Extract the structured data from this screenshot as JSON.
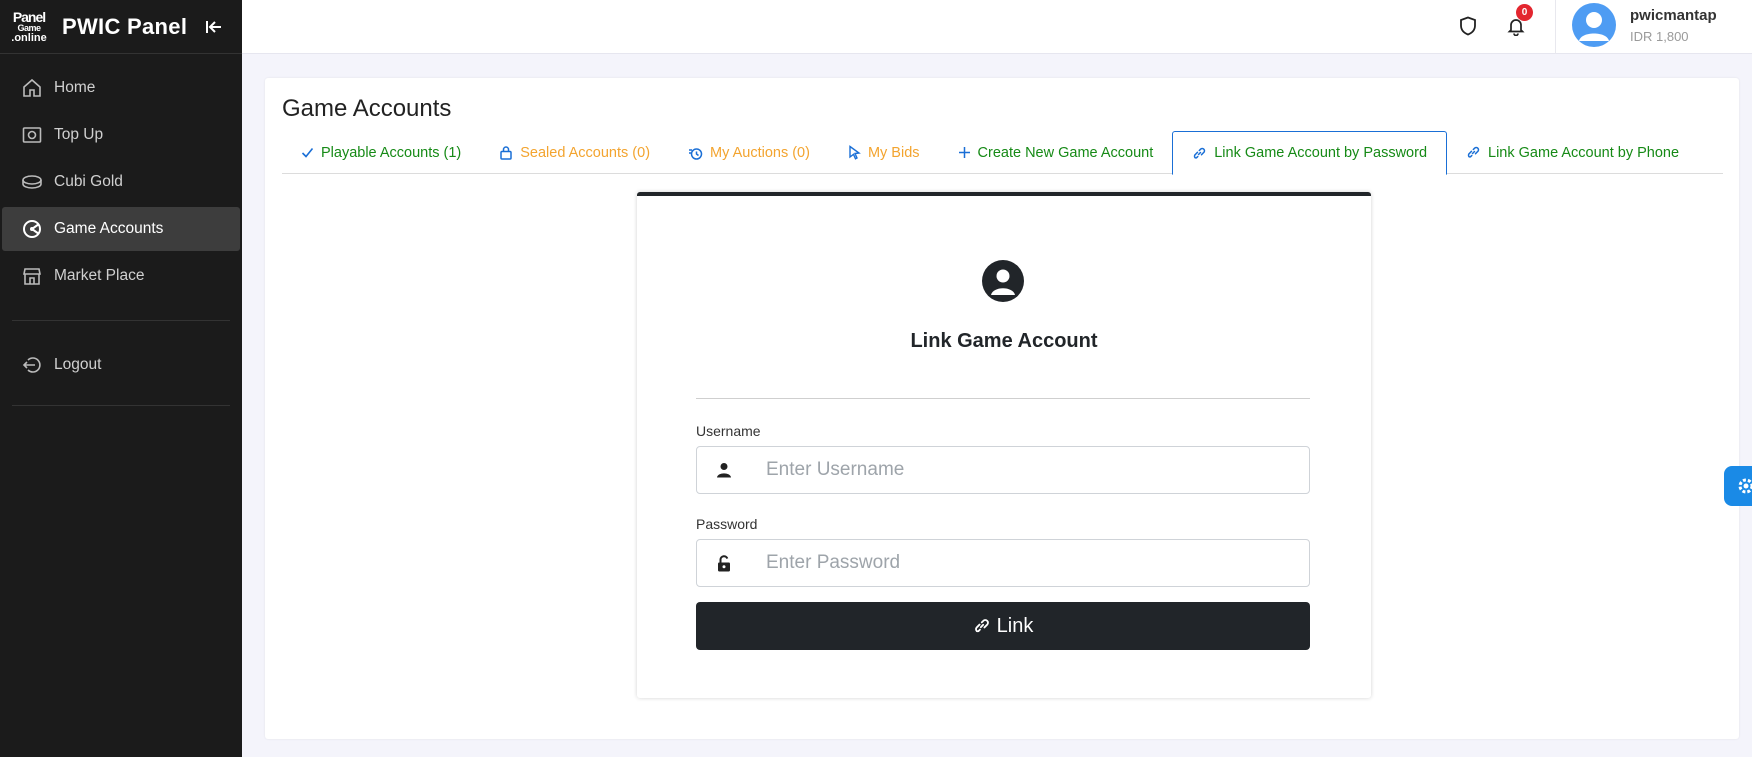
{
  "brand": {
    "logo_line1": "Panel",
    "logo_line2": "Game",
    "logo_line3": ".online",
    "title": "PWIC Panel"
  },
  "sidebar": {
    "items": [
      {
        "label": "Home",
        "icon": "home-icon"
      },
      {
        "label": "Top Up",
        "icon": "money-icon"
      },
      {
        "label": "Cubi Gold",
        "icon": "coin-icon"
      },
      {
        "label": "Game Accounts",
        "icon": "game-icon",
        "active": true
      },
      {
        "label": "Market Place",
        "icon": "store-icon"
      }
    ],
    "logout_label": "Logout"
  },
  "topbar": {
    "notification_count": "0",
    "user_name": "pwicmantap",
    "user_balance": "IDR 1,800"
  },
  "page": {
    "title": "Game Accounts",
    "tabs": [
      {
        "label": "Playable Accounts (1)",
        "icon": "check-icon",
        "color": "#168a16"
      },
      {
        "label": "Sealed Accounts (0)",
        "icon": "lock-icon",
        "color": "#f3a42f"
      },
      {
        "label": "My Auctions (0)",
        "icon": "auction-icon",
        "color": "#f3a42f"
      },
      {
        "label": "My Bids",
        "icon": "cursor-icon",
        "color": "#f3a42f"
      },
      {
        "label": "Create New Game Account",
        "icon": "plus-icon",
        "color": "#168a16"
      },
      {
        "label": "Link Game Account by Password",
        "icon": "link-icon",
        "color": "#168a16",
        "active": true
      },
      {
        "label": "Link Game Account by Phone",
        "icon": "link-icon",
        "color": "#168a16"
      }
    ]
  },
  "form": {
    "title": "Link Game Account",
    "username_label": "Username",
    "username_placeholder": "Enter Username",
    "username_value": "",
    "password_label": "Password",
    "password_placeholder": "Enter Password",
    "password_value": "",
    "submit_label": "Link"
  },
  "colors": {
    "sidebar_bg": "#1b1b1b",
    "accent_blue": "#1a6fd6",
    "green": "#168a16",
    "orange": "#f3a42f",
    "dark": "#212529",
    "badge_red": "#e3262f"
  }
}
